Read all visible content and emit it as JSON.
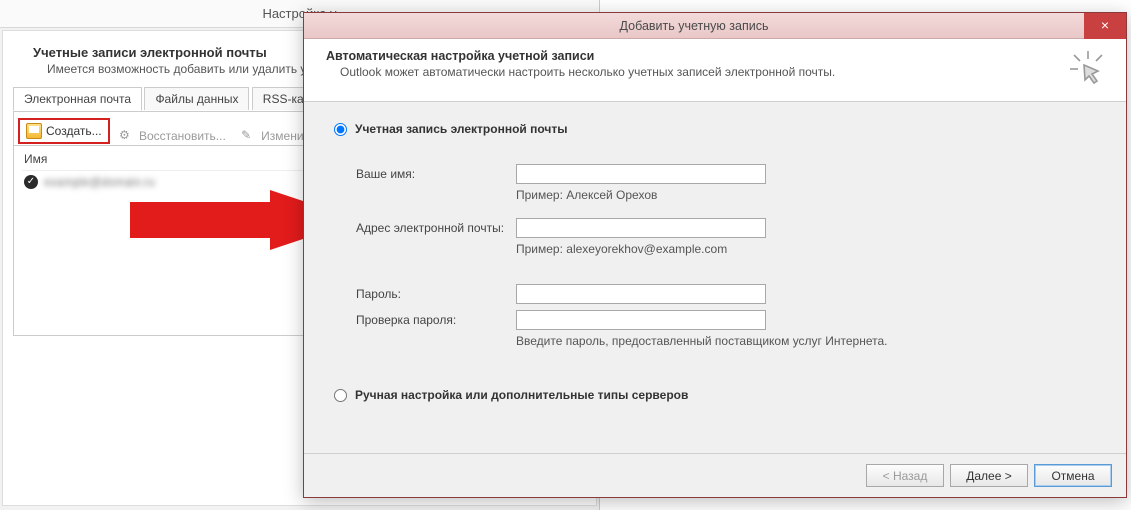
{
  "bg": {
    "title": "Настройка у",
    "heading": "Учетные записи электронной почты",
    "sub": "Имеется возможность добавить или удалить учетную запись и изменить ее параметры.",
    "tabs": [
      "Электронная почта",
      "Файлы данных",
      "RSS-каналы"
    ],
    "toolbar": {
      "create": "Создать...",
      "restore": "Восстановить...",
      "edit": "Изменить..."
    },
    "col_name": "Имя",
    "account_placeholder": "example@domain.ru"
  },
  "wizard": {
    "title": "Добавить учетную запись",
    "h1": "Автоматическая настройка учетной записи",
    "h2": "Outlook может автоматически настроить несколько учетных записей электронной почты.",
    "radio_auto": "Учетная запись электронной почты",
    "labels": {
      "name": "Ваше имя:",
      "email": "Адрес электронной почты:",
      "password": "Пароль:",
      "password2": "Проверка пароля:"
    },
    "hints": {
      "name": "Пример: Алексей Орехов",
      "email": "Пример: alexeyorekhov@example.com",
      "password": "Введите пароль, предоставленный поставщиком услуг Интернета."
    },
    "radio_manual": "Ручная настройка или дополнительные типы серверов",
    "buttons": {
      "back": "< Назад",
      "next": "Далее >",
      "cancel": "Отмена"
    }
  }
}
